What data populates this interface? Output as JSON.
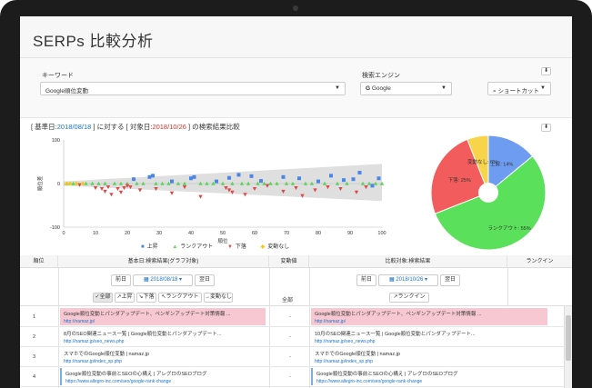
{
  "app": {
    "title": "SERPs 比較分析"
  },
  "filters": {
    "keyword_label": "キーワード",
    "keyword_value": "Google順位変動",
    "engine_label": "検索エンジン",
    "engine_value": "Google",
    "shortcut_label": "ショートカット",
    "collapse_glyph": "⬇"
  },
  "chart_header": {
    "prefix": "[ 基準日:",
    "base_date": "2018/08/18",
    "middle": " ] に対する [ 対象日:",
    "target_date": "2018/10/26",
    "suffix": " ] の検索結果比較"
  },
  "chart_data": [
    {
      "type": "scatter",
      "ylabel": "順位差",
      "xlabel": "順位",
      "xlim": [
        0,
        100
      ],
      "ylim": [
        -100,
        100
      ],
      "xticks": [
        "0",
        "10",
        "20",
        "30",
        "40",
        "50",
        "60",
        "70",
        "80",
        "90",
        "100"
      ],
      "yticks": [
        "100",
        "0",
        "-100"
      ],
      "series": [
        {
          "name": "上昇",
          "color": "#4a86e8",
          "marker": "square",
          "points": [
            [
              22,
              10
            ],
            [
              27,
              15
            ],
            [
              34,
              5
            ],
            [
              40,
              12
            ],
            [
              41,
              15
            ],
            [
              48,
              5
            ],
            [
              52,
              13
            ],
            [
              55,
              20
            ],
            [
              59,
              17
            ],
            [
              69,
              15
            ],
            [
              74,
              12
            ],
            [
              80,
              5
            ],
            [
              84,
              18
            ],
            [
              88,
              8
            ],
            [
              91,
              10
            ],
            [
              93,
              25
            ],
            [
              97,
              -5
            ],
            [
              99,
              12
            ],
            [
              28,
              18
            ],
            [
              62,
              6
            ]
          ]
        },
        {
          "name": "ランクアウト",
          "color": "#5ad35a",
          "marker": "triangle",
          "points": [
            [
              1,
              0
            ],
            [
              3,
              0
            ],
            [
              7,
              0
            ],
            [
              9,
              0
            ],
            [
              11,
              0
            ],
            [
              13,
              0
            ],
            [
              16,
              0
            ],
            [
              18,
              0
            ],
            [
              20,
              0
            ],
            [
              23,
              0
            ],
            [
              25,
              0
            ],
            [
              29,
              0
            ],
            [
              31,
              0
            ],
            [
              33,
              0
            ],
            [
              36,
              0
            ],
            [
              38,
              0
            ],
            [
              43,
              0
            ],
            [
              45,
              0
            ],
            [
              47,
              0
            ],
            [
              50,
              0
            ],
            [
              53,
              0
            ],
            [
              56,
              0
            ],
            [
              58,
              0
            ],
            [
              61,
              0
            ],
            [
              63,
              0
            ],
            [
              65,
              0
            ],
            [
              67,
              0
            ],
            [
              70,
              0
            ],
            [
              72,
              0
            ],
            [
              76,
              0
            ],
            [
              78,
              0
            ],
            [
              82,
              0
            ],
            [
              86,
              0
            ],
            [
              89,
              0
            ],
            [
              94,
              0
            ],
            [
              96,
              0
            ],
            [
              98,
              0
            ],
            [
              100,
              0
            ]
          ]
        },
        {
          "name": "下落",
          "color": "#e04848",
          "marker": "triangle-down",
          "points": [
            [
              5,
              -3
            ],
            [
              10,
              -10
            ],
            [
              12,
              -12
            ],
            [
              13,
              -18
            ],
            [
              14,
              -8
            ],
            [
              15,
              -25
            ],
            [
              17,
              -12
            ],
            [
              18,
              -20
            ],
            [
              19,
              -10
            ],
            [
              20,
              -5
            ],
            [
              21,
              -8
            ],
            [
              24,
              -15
            ],
            [
              29,
              -12
            ],
            [
              34,
              -22
            ],
            [
              38,
              -8
            ],
            [
              43,
              -30
            ],
            [
              51,
              -10
            ],
            [
              52,
              -15
            ],
            [
              53,
              -20
            ],
            [
              57,
              -25
            ],
            [
              60,
              -12
            ],
            [
              64,
              -5
            ],
            [
              69,
              -18
            ],
            [
              73,
              -10
            ],
            [
              75,
              -28
            ],
            [
              79,
              -15
            ],
            [
              83,
              -8
            ],
            [
              87,
              -12
            ],
            [
              92,
              -20
            ],
            [
              95,
              -8
            ]
          ]
        },
        {
          "name": "変動なし",
          "color": "#f5c518",
          "marker": "diamond",
          "points": [
            [
              1,
              0
            ],
            [
              2,
              0
            ],
            [
              4,
              0
            ],
            [
              6,
              0
            ]
          ]
        }
      ]
    },
    {
      "type": "pie",
      "slices": [
        {
          "label": "上昇",
          "value": 14,
          "display": "上昇: 14%",
          "color": "#6e9cf0"
        },
        {
          "label": "ランクアウト",
          "value": 55,
          "display": "ランクアウト: 55%",
          "color": "#5be05b"
        },
        {
          "label": "下落",
          "value": 25,
          "display": "下落: 25%",
          "color": "#f25c5c"
        },
        {
          "label": "変動なし",
          "value": 6,
          "display": "変動なし: 6%",
          "color": "#f7d44a"
        }
      ]
    }
  ],
  "legend": [
    {
      "label": "上昇",
      "glyph": "■",
      "color": "#4a86e8"
    },
    {
      "label": "ランクアウト",
      "glyph": "▲",
      "color": "#5ad35a"
    },
    {
      "label": "下落",
      "glyph": "▼",
      "color": "#e04848"
    },
    {
      "label": "変動なし",
      "glyph": "◆",
      "color": "#f5c518"
    }
  ],
  "table": {
    "headers": {
      "rank": "順位",
      "base": "基本日:検索結果(グラフ対象)",
      "change": "変動値",
      "compare": "比較対象:検索結果",
      "rankin": "ランクイン"
    },
    "base_controls": {
      "prev": "前日",
      "date": "2018/08/18",
      "next": "翌日",
      "filters": [
        "全部",
        "上昇",
        "下落",
        "ランクアウト",
        "変動なし"
      ]
    },
    "change_filter": "全部",
    "compare_controls": {
      "prev": "前日",
      "date": "2018/10/26",
      "next": "翌日",
      "filter": "ランクイン"
    },
    "rows": [
      {
        "rank": "1",
        "base_title": "Google順位変動とパンダアップデート、ペンギンアップデート対策情報 ...",
        "base_url": "http://namaz.jp/",
        "change": "-",
        "cmp_title": "Google順位変動とパンダアップデート、ペンギンアップデート対策情報 ...",
        "cmp_url": "http://namaz.jp/"
      },
      {
        "rank": "2",
        "base_title": "8月のSEO関連ニュース一覧 | Google順位変動とパンダアップデート...",
        "base_url": "http://namaz.jp/seo_news.php",
        "change": "-",
        "cmp_title": "10月のSEO関連ニュース一覧 | Google順位変動とパンダアップデート...",
        "cmp_url": "http://namaz.jp/seo_news.php"
      },
      {
        "rank": "3",
        "base_title": "スマホでのGoogle順位変動 | namaz.jp",
        "base_url": "http://namaz.jp/index_sp.php",
        "change": "-",
        "cmp_title": "スマホでのGoogle順位変動 | namaz.jp",
        "cmp_url": "http://namaz.jp/index_sp.php"
      },
      {
        "rank": "4",
        "base_title": "Google順位変動の事前とSEOの心構え | アレグロのSEOブログ",
        "base_url": "https://www.allegro-inc.com/seo/google-rank-change",
        "change": "-",
        "cmp_title": "Google順位変動の事前とSEOの心構え | アレグロのSEOブログ",
        "cmp_url": "https://www.allegro-inc.com/seo/google-rank-change"
      }
    ]
  }
}
